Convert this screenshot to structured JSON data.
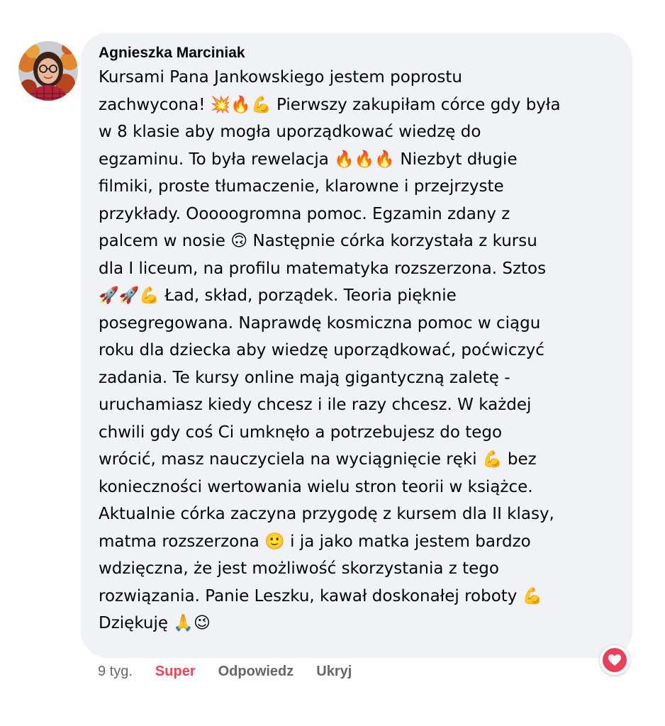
{
  "comment": {
    "author": "Agnieszka Marciniak",
    "lines": [
      "Kursami Pana Jankowskiego jestem poprostu",
      "zachwycona! 💥🔥💪 Pierwszy zakupiłam córce gdy była",
      "w 8 klasie aby mogła uporządkować wiedzę do",
      "egzaminu. To była rewelacja 🔥🔥🔥 Niezbyt długie",
      "filmiki, proste tłumaczenie, klarowne i przejrzyste",
      "przykłady. Ooooogromna pomoc. Egzamin zdany z",
      "palcem w nosie 🙃 Następnie córka korzystała z kursu",
      "dla I liceum, na profilu matematyka rozszerzona. Sztos",
      "🚀🚀💪 Ład, skład, porządek. Teoria pięknie",
      "posegregowana. Naprawdę kosmiczna pomoc w ciągu",
      "roku dla dziecka aby wiedzę uporządkować, poćwiczyć",
      "zadania. Te kursy online mają gigantyczną zaletę -",
      "uruchamiasz kiedy chcesz i ile razy chcesz. W każdej",
      "chwili gdy coś Ci umknęło a potrzebujesz do tego",
      "wrócić, masz nauczyciela na wyciągnięcie ręki 💪 bez",
      "konieczności wertowania wielu stron teorii w książce.",
      "Aktualnie córka zaczyna przygodę z kursem dla II klasy,",
      "matma rozszerzona 🙂 i ja jako matka jestem bardzo",
      "wdzięczna, że jest możliwość skorzystania z tego",
      "rozwiązania. Panie Leszku, kawał doskonałej roboty 💪",
      "Dziękuję 🙏😉"
    ],
    "reaction_icon": "heart-icon",
    "reaction_color": "#f33e58"
  },
  "actions": {
    "time": "9 tyg.",
    "react_label": "Super",
    "reply_label": "Odpowiedz",
    "hide_label": "Ukryj"
  }
}
